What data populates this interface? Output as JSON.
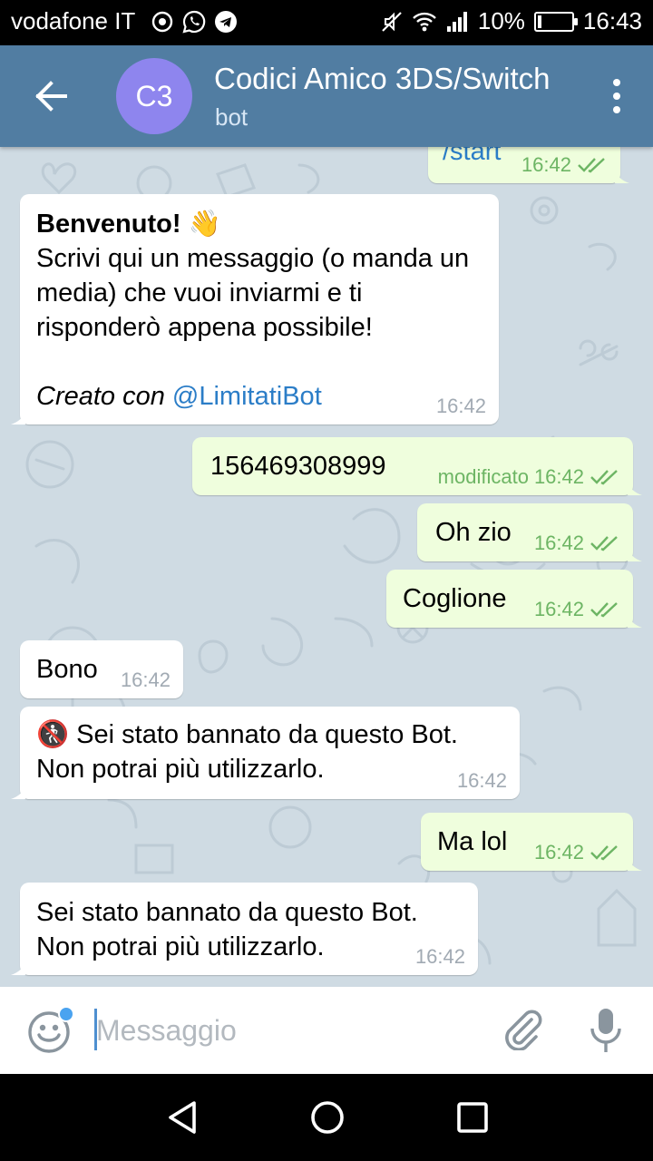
{
  "status_bar": {
    "carrier": "vodafone IT",
    "battery": "10%",
    "battery_level": 0.1,
    "time": "16:43"
  },
  "header": {
    "avatar_initials": "C3",
    "avatar_color": "#8e85ee",
    "title": "Codici Amico 3DS/Switch",
    "subtitle": "bot",
    "background": "#517da2"
  },
  "messages": [
    {
      "direction": "out",
      "text": "/start",
      "time": "16:42",
      "read": true
    },
    {
      "direction": "in",
      "bold": "Benvenuto!",
      "emoji": "👋",
      "text": "Scrivi qui un messaggio (o manda un media) che vuoi inviarmi e ti risponderò appena possibile!",
      "footer_prefix": "Creato con ",
      "footer_link": "@LimitatiBot",
      "time": "16:42"
    },
    {
      "direction": "out",
      "text": "156469308999",
      "edited_label": "modificato",
      "time": "16:42",
      "read": true
    },
    {
      "direction": "out",
      "text": "Oh zio",
      "time": "16:42",
      "read": true
    },
    {
      "direction": "out",
      "text": "Coglione",
      "time": "16:42",
      "read": true
    },
    {
      "direction": "in",
      "text": "Bono",
      "time": "16:42"
    },
    {
      "direction": "in",
      "emoji": "🚷",
      "line1": "Sei stato bannato da questo Bot.",
      "line2": "Non potrai più utilizzarlo.",
      "time": "16:42"
    },
    {
      "direction": "out",
      "text": "Ma lol",
      "time": "16:42",
      "read": true
    },
    {
      "direction": "in",
      "line1": "Sei stato bannato da questo Bot.",
      "line2": "Non potrai più utilizzarlo.",
      "time": "16:42"
    }
  ],
  "input": {
    "placeholder": "Messaggio",
    "value": ""
  },
  "colors": {
    "chat_background": "#cfdbe3",
    "incoming_bubble": "#ffffff",
    "outgoing_bubble": "#effedd",
    "outgoing_meta": "#6db564",
    "link": "#2b7dc7",
    "notification_dot": "#4aa3f0"
  },
  "icons": {
    "back": "arrow-left-icon",
    "menu": "more-vertical-icon",
    "emoji": "smiley-icon",
    "attach": "paperclip-icon",
    "mic": "microphone-icon",
    "read_receipt": "double-check-icon"
  }
}
